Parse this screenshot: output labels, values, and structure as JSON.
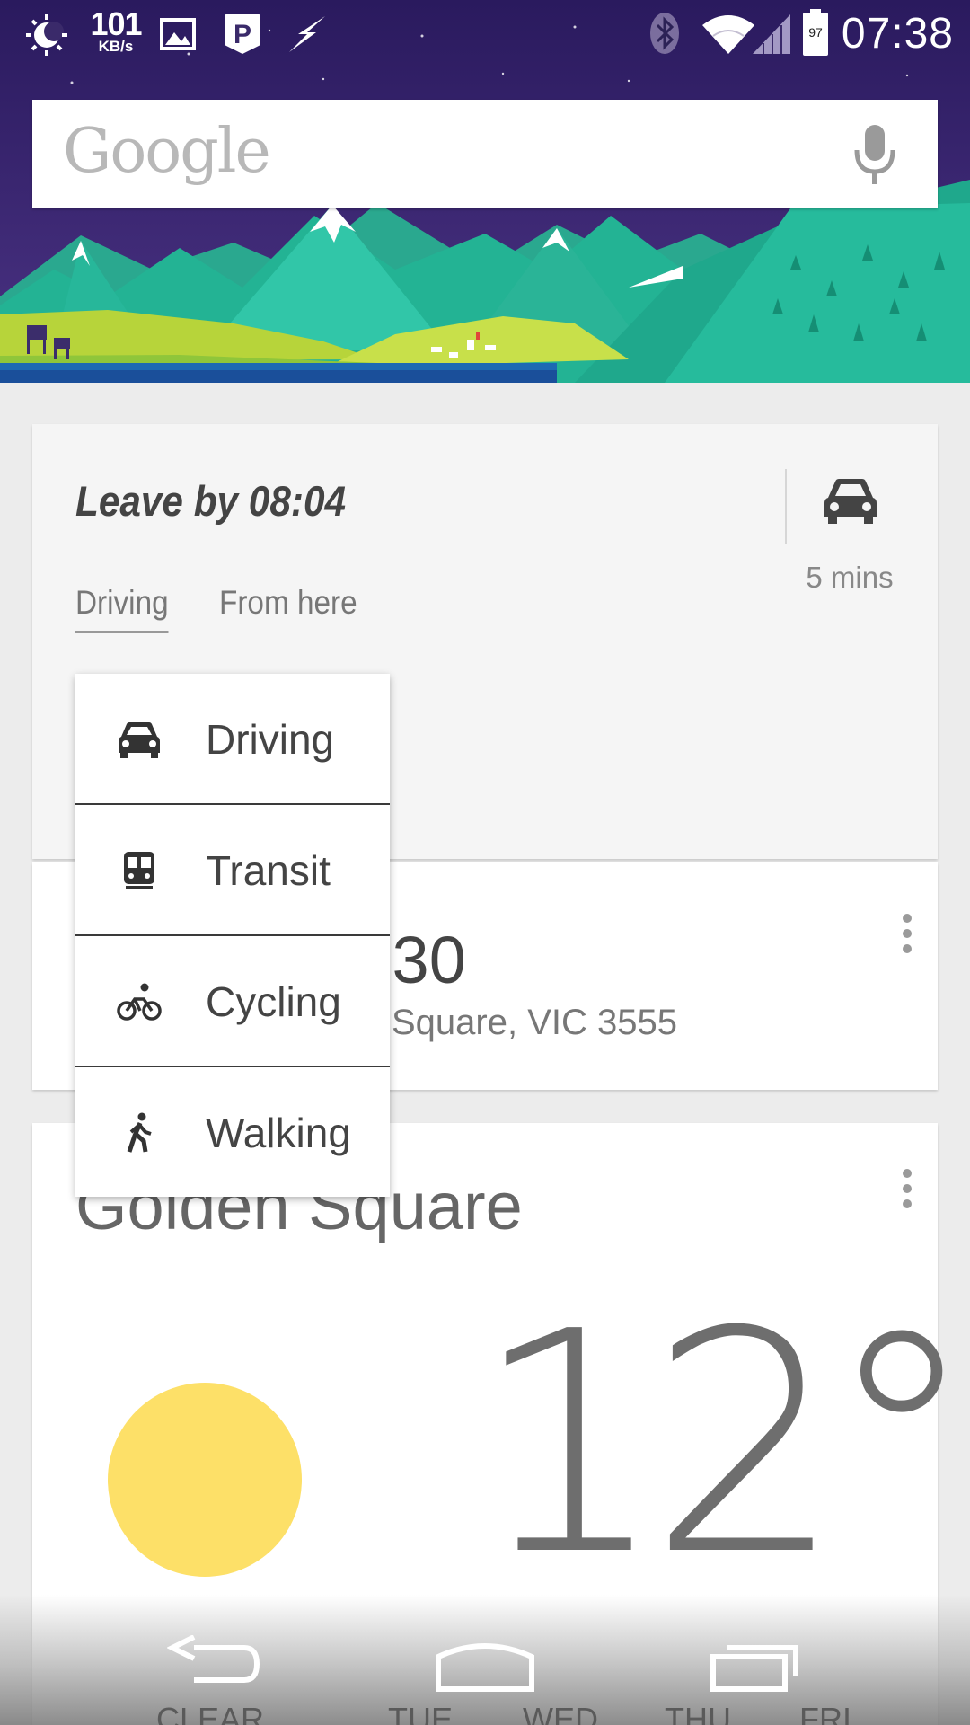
{
  "status_bar": {
    "net_speed_value": "101",
    "net_speed_unit": "KB/s",
    "battery_level": "97",
    "time": "07:38",
    "icons": [
      "brightness-icon",
      "image-icon",
      "parking-icon",
      "lightning-icon",
      "bluetooth-icon",
      "wifi-icon",
      "signal-icon",
      "battery-icon"
    ]
  },
  "search": {
    "logo": "Google",
    "mic_icon": "mic-icon"
  },
  "commute_card": {
    "title": "Leave by 08:04",
    "duration": "5 mins",
    "mode_tab": "Driving",
    "origin_tab": "From here"
  },
  "mode_menu": {
    "items": [
      {
        "label": "Driving",
        "icon": "car-icon"
      },
      {
        "label": "Transit",
        "icon": "train-icon"
      },
      {
        "label": "Cycling",
        "icon": "bicycle-icon"
      },
      {
        "label": "Walking",
        "icon": "walking-icon"
      }
    ]
  },
  "event_card": {
    "time": ":30",
    "place": "Square, VIC 3555"
  },
  "weather_card": {
    "location": "Golden Square",
    "temperature": "12°",
    "condition_icon": "sun-icon",
    "days": [
      "CLEAR",
      "TUE",
      "WED",
      "THU",
      "FRI"
    ]
  },
  "colors": {
    "sky": "#3a2a72",
    "mountain": "#2ebfa3",
    "meadow": "#b7d43a",
    "sun": "#fde068",
    "card_text": "#444444"
  }
}
